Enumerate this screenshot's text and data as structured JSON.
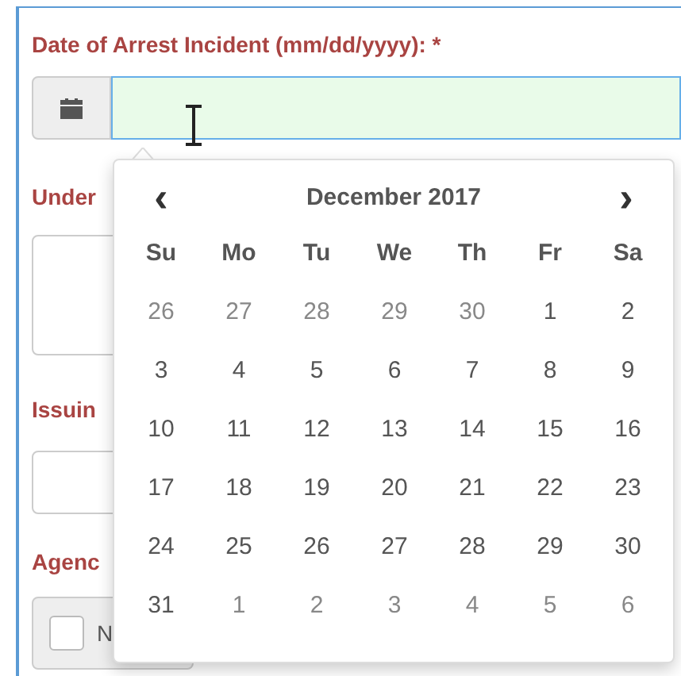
{
  "date_field": {
    "label": "Date of Arrest Incident (mm/dd/yyyy): *"
  },
  "background_fields": [
    {
      "label": "Under",
      "kind": "textarea"
    },
    {
      "label": "Issuin",
      "kind": "input"
    },
    {
      "label": "Agenc",
      "kind": "checkbox",
      "option": "N",
      "checked": false
    }
  ],
  "datepicker": {
    "prev": "‹",
    "next": "›",
    "title": "December 2017",
    "weekdays": [
      "Su",
      "Mo",
      "Tu",
      "We",
      "Th",
      "Fr",
      "Sa"
    ],
    "weeks": [
      [
        {
          "day": "26",
          "outside": true
        },
        {
          "day": "27",
          "outside": true
        },
        {
          "day": "28",
          "outside": true
        },
        {
          "day": "29",
          "outside": true
        },
        {
          "day": "30",
          "outside": true
        },
        {
          "day": "1",
          "outside": false
        },
        {
          "day": "2",
          "outside": false
        }
      ],
      [
        {
          "day": "3",
          "outside": false
        },
        {
          "day": "4",
          "outside": false
        },
        {
          "day": "5",
          "outside": false
        },
        {
          "day": "6",
          "outside": false
        },
        {
          "day": "7",
          "outside": false
        },
        {
          "day": "8",
          "outside": false
        },
        {
          "day": "9",
          "outside": false
        }
      ],
      [
        {
          "day": "10",
          "outside": false
        },
        {
          "day": "11",
          "outside": false
        },
        {
          "day": "12",
          "outside": false
        },
        {
          "day": "13",
          "outside": false
        },
        {
          "day": "14",
          "outside": false
        },
        {
          "day": "15",
          "outside": false
        },
        {
          "day": "16",
          "outside": false
        }
      ],
      [
        {
          "day": "17",
          "outside": false
        },
        {
          "day": "18",
          "outside": false
        },
        {
          "day": "19",
          "outside": false
        },
        {
          "day": "20",
          "outside": false
        },
        {
          "day": "21",
          "outside": false
        },
        {
          "day": "22",
          "outside": false
        },
        {
          "day": "23",
          "outside": false
        }
      ],
      [
        {
          "day": "24",
          "outside": false
        },
        {
          "day": "25",
          "outside": false
        },
        {
          "day": "26",
          "outside": false
        },
        {
          "day": "27",
          "outside": false
        },
        {
          "day": "28",
          "outside": false
        },
        {
          "day": "29",
          "outside": false
        },
        {
          "day": "30",
          "outside": false
        }
      ],
      [
        {
          "day": "31",
          "outside": false
        },
        {
          "day": "1",
          "outside": true
        },
        {
          "day": "2",
          "outside": true
        },
        {
          "day": "3",
          "outside": true
        },
        {
          "day": "4",
          "outside": true
        },
        {
          "day": "5",
          "outside": true
        },
        {
          "day": "6",
          "outside": true
        }
      ]
    ]
  }
}
